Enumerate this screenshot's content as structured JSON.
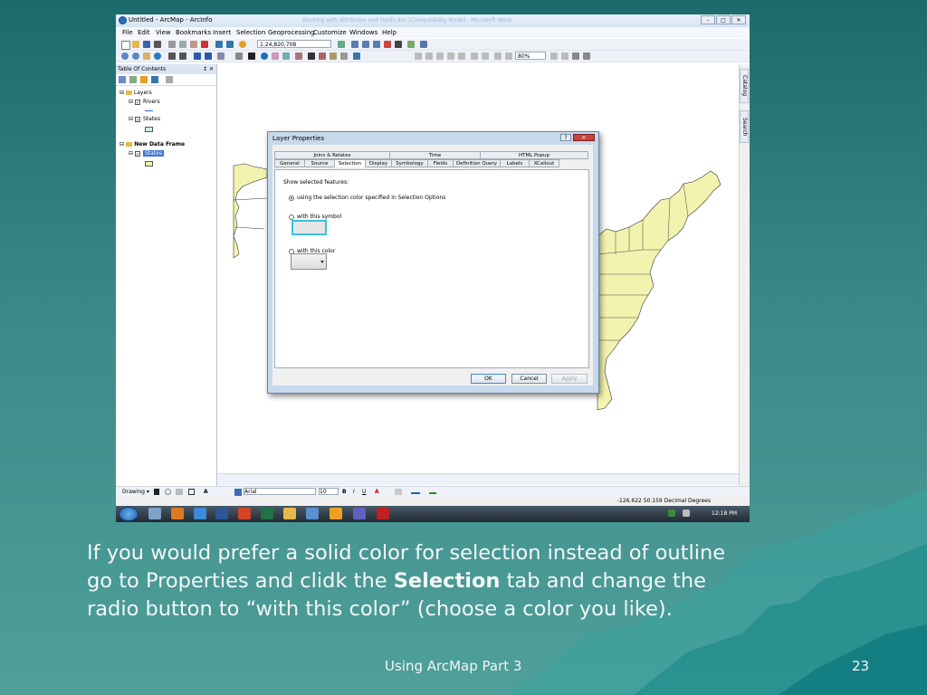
{
  "window": {
    "title": "Untitled - ArcMap - ArcInfo",
    "background_title": "Working with Attributes and Fields.doc [Compatibility Mode] - Microsoft Word",
    "controls": [
      "–",
      "□",
      "✕"
    ]
  },
  "menu": [
    "File",
    "Edit",
    "View",
    "Bookmarks",
    "Insert",
    "Selection",
    "Geoprocessing",
    "Customize",
    "Windows",
    "Help"
  ],
  "toolbar": {
    "scale": "1:24,820,708",
    "zoom": "80%"
  },
  "toc": {
    "title": "Table Of Contents",
    "pin": "↕ ✕",
    "layers_group": "Layers",
    "rivers": "Rivers",
    "states": "States",
    "data_frame": "New Data Frame",
    "states_selected": "States"
  },
  "side_tabs": {
    "catalog": "Catalog",
    "search": "Search"
  },
  "dialog": {
    "title": "Layer Properties",
    "help": "?",
    "close": "✕",
    "tabs_top": [
      "Joins & Relates",
      "Time",
      "HTML Popup"
    ],
    "tabs_bottom": [
      "General",
      "Source",
      "Selection",
      "Display",
      "Symbology",
      "Fields",
      "Definition Query",
      "Labels",
      "XCallout"
    ],
    "heading": "Show selected features:",
    "option1": "using the selection color specified in Selection Options",
    "option2": "with this symbol",
    "option3": "with this color",
    "selected_option": 1,
    "ok": "OK",
    "cancel": "Cancel",
    "apply": "Apply"
  },
  "drawing_bar": {
    "drawing": "Drawing ▾",
    "font": "Arial",
    "size": "10"
  },
  "status": {
    "coords": "-126.622  50.159 Decimal Degrees"
  },
  "taskbar": {
    "time": "12:18 PM"
  },
  "slide": {
    "caption_part1": "If you would prefer a solid color for selection instead of outline go to Properties and clidk the",
    "caption_bold": "Selection",
    "caption_part2": "tab and change the radio button to “with this color” (choose a color you like).",
    "footer_title": "Using ArcMap Part 3",
    "page_number": "23"
  },
  "colors": {
    "slide_teal": "#2f7f7e",
    "map_fill": "#f3f3b0",
    "selection_highlight": "#39c3dd"
  }
}
